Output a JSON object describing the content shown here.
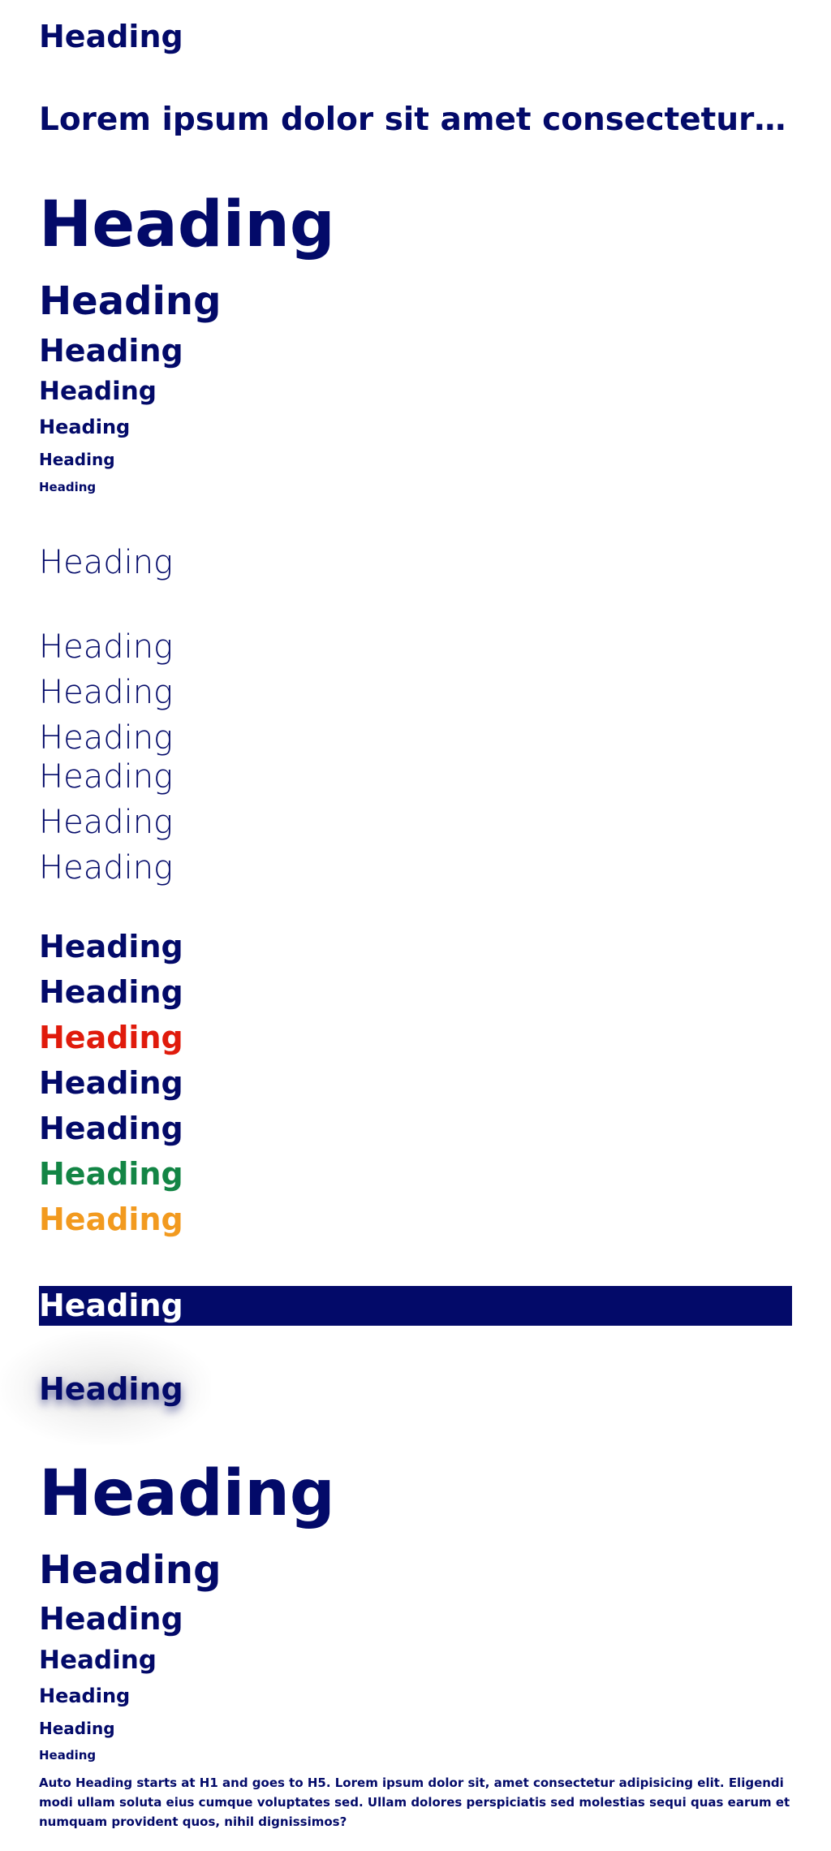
{
  "headings": {
    "h_top": "Heading",
    "long_title": "Lorem ipsum dolor sit amet consectetur adipisicing elit",
    "bold_sizes": [
      "Heading",
      "Heading",
      "Heading",
      "Heading",
      "Heading",
      "Heading",
      "Heading"
    ],
    "light_single": "Heading",
    "light_list": [
      "Heading",
      "Heading",
      "Heading",
      "Heading",
      "Heading",
      "Heading"
    ],
    "colored": [
      {
        "text": "Heading",
        "color": "#030a69"
      },
      {
        "text": "Heading",
        "color": "#030a69"
      },
      {
        "text": "Heading",
        "color": "#e01b0c"
      },
      {
        "text": "Heading",
        "color": "#030a69"
      },
      {
        "text": "Heading",
        "color": "#030a69"
      },
      {
        "text": "Heading",
        "color": "#138545"
      },
      {
        "text": "Heading",
        "color": "#f29a1f"
      }
    ],
    "banner": "Heading",
    "shadow": "Heading",
    "auto_sizes": [
      "Heading",
      "Heading",
      "Heading",
      "Heading",
      "Heading",
      "Heading",
      "Heading"
    ]
  },
  "auto_paragraph": "Auto Heading starts at H1 and goes to H5. Lorem ipsum dolor sit, amet consectetur adipisicing elit. Eligendi modi ullam soluta eius cumque voluptates sed. Ullam dolores perspiciatis sed molestias sequi quas earum et numquam provident quos, nihil dignissimos?",
  "colors": {
    "primary": "#030a69",
    "red": "#e01b0c",
    "green": "#138545",
    "orange": "#f29a1f",
    "banner_bg": "#030a69",
    "banner_text": "#ffffff"
  }
}
